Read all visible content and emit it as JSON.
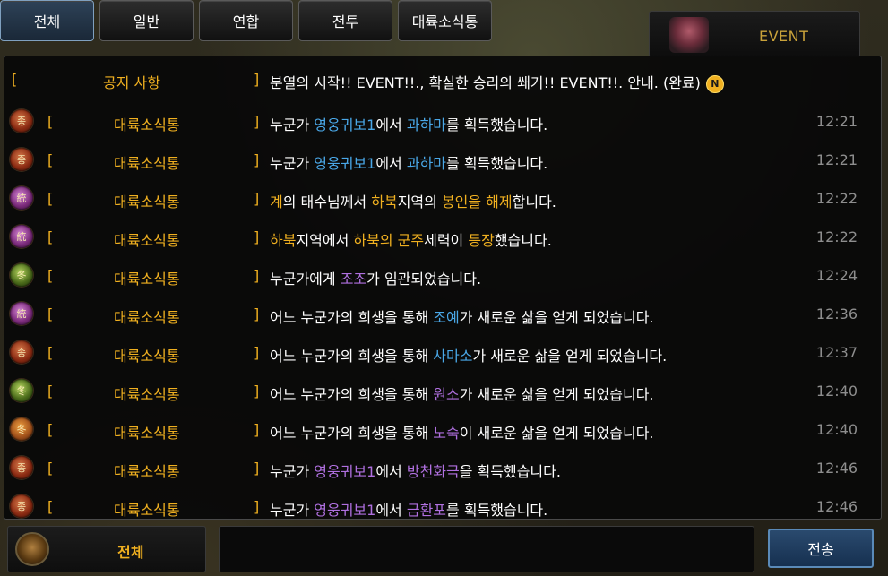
{
  "tabs": [
    {
      "label": "전체",
      "active": true
    },
    {
      "label": "일반",
      "active": false
    },
    {
      "label": "연합",
      "active": false
    },
    {
      "label": "전투",
      "active": false
    },
    {
      "label": "대륙소식통",
      "active": false
    }
  ],
  "event": {
    "label": "EVENT"
  },
  "notice": {
    "bracket_left": "[",
    "category": "공지 사항",
    "bracket_right": "]",
    "message": "분열의 시작!! EVENT!!., 확실한 승리의 쐐기!! EVENT!!. 안내. (완료)",
    "badge": "N"
  },
  "messages": [
    {
      "icon": "icon-red",
      "icon_glyph": "종",
      "category": "대륙소식통",
      "time": "12:21",
      "parts": [
        [
          "누군가 ",
          "white"
        ],
        [
          "영웅귀보1",
          "blue"
        ],
        [
          "에서 ",
          "white"
        ],
        [
          "과하마",
          "blue"
        ],
        [
          "를 획득했습니다.",
          "white"
        ]
      ]
    },
    {
      "icon": "icon-red",
      "icon_glyph": "종",
      "category": "대륙소식통",
      "time": "12:21",
      "parts": [
        [
          "누군가 ",
          "white"
        ],
        [
          "영웅귀보1",
          "blue"
        ],
        [
          "에서 ",
          "white"
        ],
        [
          "과하마",
          "blue"
        ],
        [
          "를 획득했습니다.",
          "white"
        ]
      ]
    },
    {
      "icon": "icon-purple",
      "icon_glyph": "統",
      "category": "대륙소식통",
      "time": "12:22",
      "parts": [
        [
          "계",
          "yellow"
        ],
        [
          "의 태수님께서 ",
          "white"
        ],
        [
          "하북",
          "yellow"
        ],
        [
          "지역의 ",
          "white"
        ],
        [
          "봉인을 해제",
          "yellow"
        ],
        [
          "합니다.",
          "white"
        ]
      ]
    },
    {
      "icon": "icon-purple",
      "icon_glyph": "統",
      "category": "대륙소식통",
      "time": "12:22",
      "parts": [
        [
          "하북",
          "yellow"
        ],
        [
          "지역에서 ",
          "white"
        ],
        [
          "하북의 군주",
          "yellow"
        ],
        [
          "세력이 ",
          "white"
        ],
        [
          "등장",
          "yellow"
        ],
        [
          "했습니다.",
          "white"
        ]
      ]
    },
    {
      "icon": "icon-green",
      "icon_glyph": "冬",
      "category": "대륙소식통",
      "time": "12:24",
      "parts": [
        [
          "누군가에게 ",
          "white"
        ],
        [
          "조조",
          "purple"
        ],
        [
          "가 임관되었습니다.",
          "white"
        ]
      ]
    },
    {
      "icon": "icon-purple",
      "icon_glyph": "統",
      "category": "대륙소식통",
      "time": "12:36",
      "parts": [
        [
          "어느 누군가의 희생을 통해 ",
          "white"
        ],
        [
          "조예",
          "sky"
        ],
        [
          "가 새로운 삶을 얻게 되었습니다.",
          "white"
        ]
      ]
    },
    {
      "icon": "icon-red",
      "icon_glyph": "종",
      "category": "대륙소식통",
      "time": "12:37",
      "parts": [
        [
          "어느 누군가의 희생을 통해 ",
          "white"
        ],
        [
          "사마소",
          "sky"
        ],
        [
          "가 새로운 삶을 얻게 되었습니다.",
          "white"
        ]
      ]
    },
    {
      "icon": "icon-green",
      "icon_glyph": "冬",
      "category": "대륙소식통",
      "time": "12:40",
      "parts": [
        [
          "어느 누군가의 희생을 통해 ",
          "white"
        ],
        [
          "원소",
          "purple"
        ],
        [
          "가 새로운 삶을 얻게 되었습니다.",
          "white"
        ]
      ]
    },
    {
      "icon": "icon-orange",
      "icon_glyph": "冬",
      "category": "대륙소식통",
      "time": "12:40",
      "parts": [
        [
          "어느 누군가의 희생을 통해 ",
          "white"
        ],
        [
          "노숙",
          "purple"
        ],
        [
          "이 새로운 삶을 얻게 되었습니다.",
          "white"
        ]
      ]
    },
    {
      "icon": "icon-red",
      "icon_glyph": "종",
      "category": "대륙소식통",
      "time": "12:46",
      "parts": [
        [
          "누군가 ",
          "white"
        ],
        [
          "영웅귀보1",
          "purple"
        ],
        [
          "에서 ",
          "white"
        ],
        [
          "방천화극",
          "purple"
        ],
        [
          "을 획득했습니다.",
          "white"
        ]
      ]
    },
    {
      "icon": "icon-red",
      "icon_glyph": "종",
      "category": "대륙소식통",
      "time": "12:46",
      "parts": [
        [
          "누군가 ",
          "white"
        ],
        [
          "영웅귀보1",
          "purple"
        ],
        [
          "에서 ",
          "white"
        ],
        [
          "금환포",
          "purple"
        ],
        [
          "를 획득했습니다.",
          "white"
        ]
      ]
    }
  ],
  "bottom": {
    "channel_label": "전체",
    "input_value": "",
    "send_label": "전송"
  },
  "colors": {
    "accent_gold": "#f0b020",
    "link_blue": "#4aa8e8",
    "highlight_purple": "#b070e0",
    "time_gray": "#8e8e8e"
  }
}
